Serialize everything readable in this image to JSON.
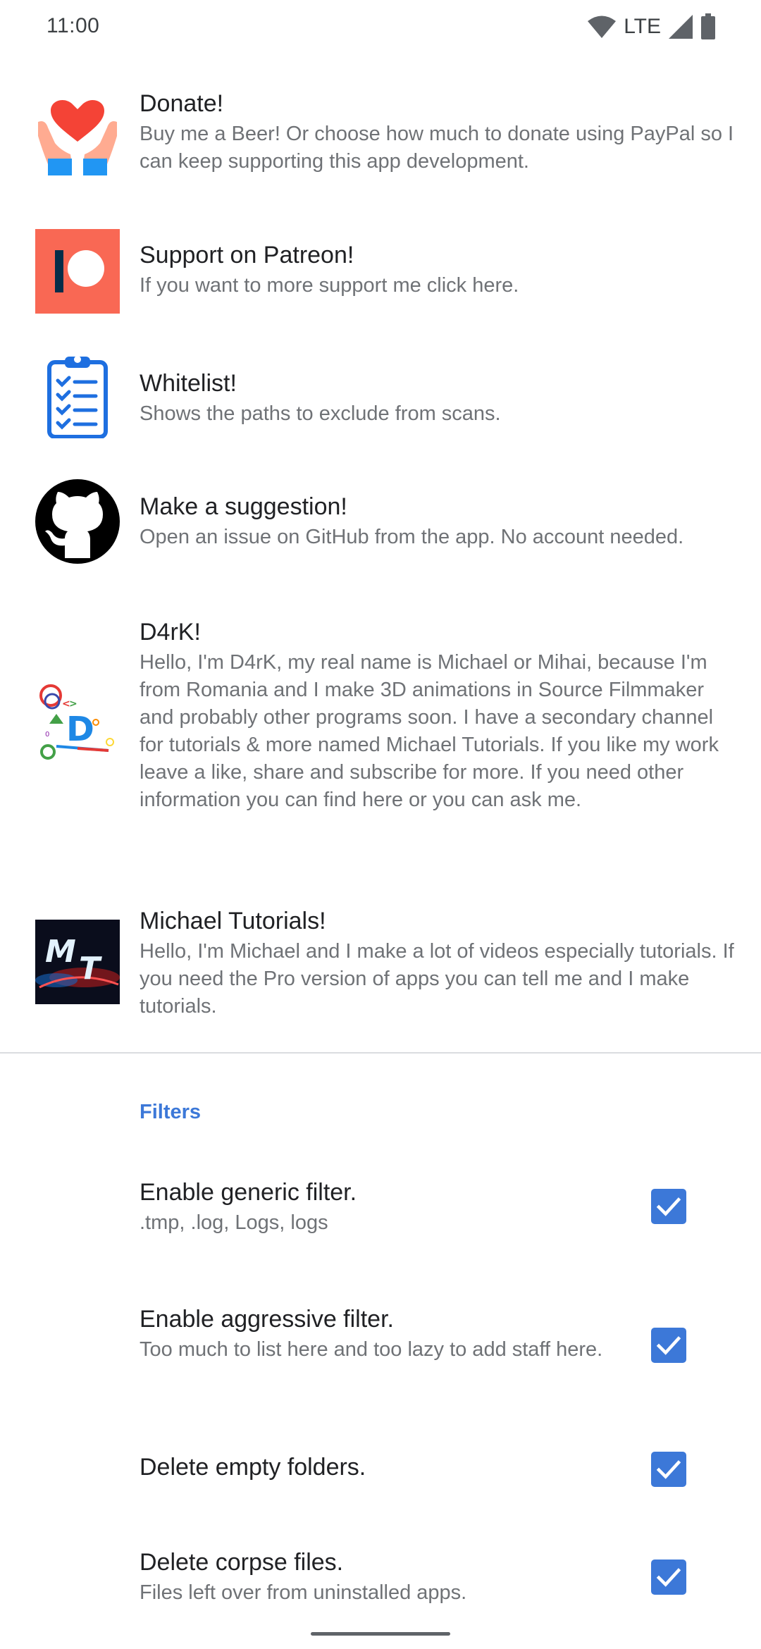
{
  "status_bar": {
    "time": "11:00",
    "network": "LTE"
  },
  "preferences": [
    {
      "icon": "donate-hands-heart-icon",
      "title": "Donate!",
      "summary": "Buy me a Beer! Or choose how much to donate using PayPal so I can keep supporting this app development."
    },
    {
      "icon": "patreon-icon",
      "title": "Support on Patreon!",
      "summary": "If you want to more support me click here."
    },
    {
      "icon": "clipboard-checklist-icon",
      "title": "Whitelist!",
      "summary": "Shows the paths to exclude from scans."
    },
    {
      "icon": "github-icon",
      "title": "Make a suggestion!",
      "summary": "Open an issue on GitHub from the app. No account needed."
    },
    {
      "icon": "d4rk-logo-icon",
      "title": "D4rK!",
      "summary": "Hello, I'm D4rK, my real name is Michael or Mihai, because I'm from Romania and I make 3D animations in Source Filmmaker and probably other programs soon. I have a secondary channel for tutorials & more named Michael Tutorials. If you like my work leave a like, share and subscribe for more. If you need other information you can find here or you can ask me."
    },
    {
      "icon": "michael-tutorials-logo-icon",
      "title": "Michael Tutorials!",
      "summary": "Hello, I'm Michael and I make a lot of videos especially tutorials. If you need the Pro version of apps you can tell me and I make tutorials."
    }
  ],
  "filters": {
    "category": "Filters",
    "accent_color": "#3c78d8",
    "items": [
      {
        "title": "Enable generic filter.",
        "summary": ".tmp, .log, Logs, logs",
        "checked": true
      },
      {
        "title": "Enable aggressive filter.",
        "summary": "Too much to list here and too lazy to add staff here.",
        "checked": true
      },
      {
        "title": "Delete empty folders.",
        "summary": "",
        "checked": true
      },
      {
        "title": "Delete corpse files.",
        "summary": "Files left over from uninstalled apps.",
        "checked": true
      }
    ]
  }
}
